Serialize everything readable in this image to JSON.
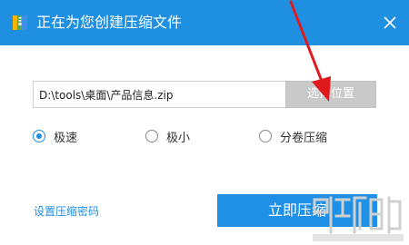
{
  "window": {
    "title": "正在为您创建压缩文件",
    "icon": "archive-app-icon",
    "close_icon": "close-icon",
    "title_bar_color": "#1e8fe1"
  },
  "path": {
    "value": "D:\\tools\\桌面\\产品信息.zip"
  },
  "browse_button": {
    "label": "选择位置"
  },
  "compression_options": [
    {
      "label": "极速",
      "checked": true
    },
    {
      "label": "极小",
      "checked": false
    },
    {
      "label": "分卷压缩",
      "checked": false
    }
  ],
  "password_link": {
    "label": "设置压缩密码"
  },
  "start_button": {
    "label": "立即压缩",
    "color": "#1e90e6"
  },
  "annotation": {
    "arrow_color": "#e0191c",
    "arrow_icon": "red-arrow-annotation"
  }
}
